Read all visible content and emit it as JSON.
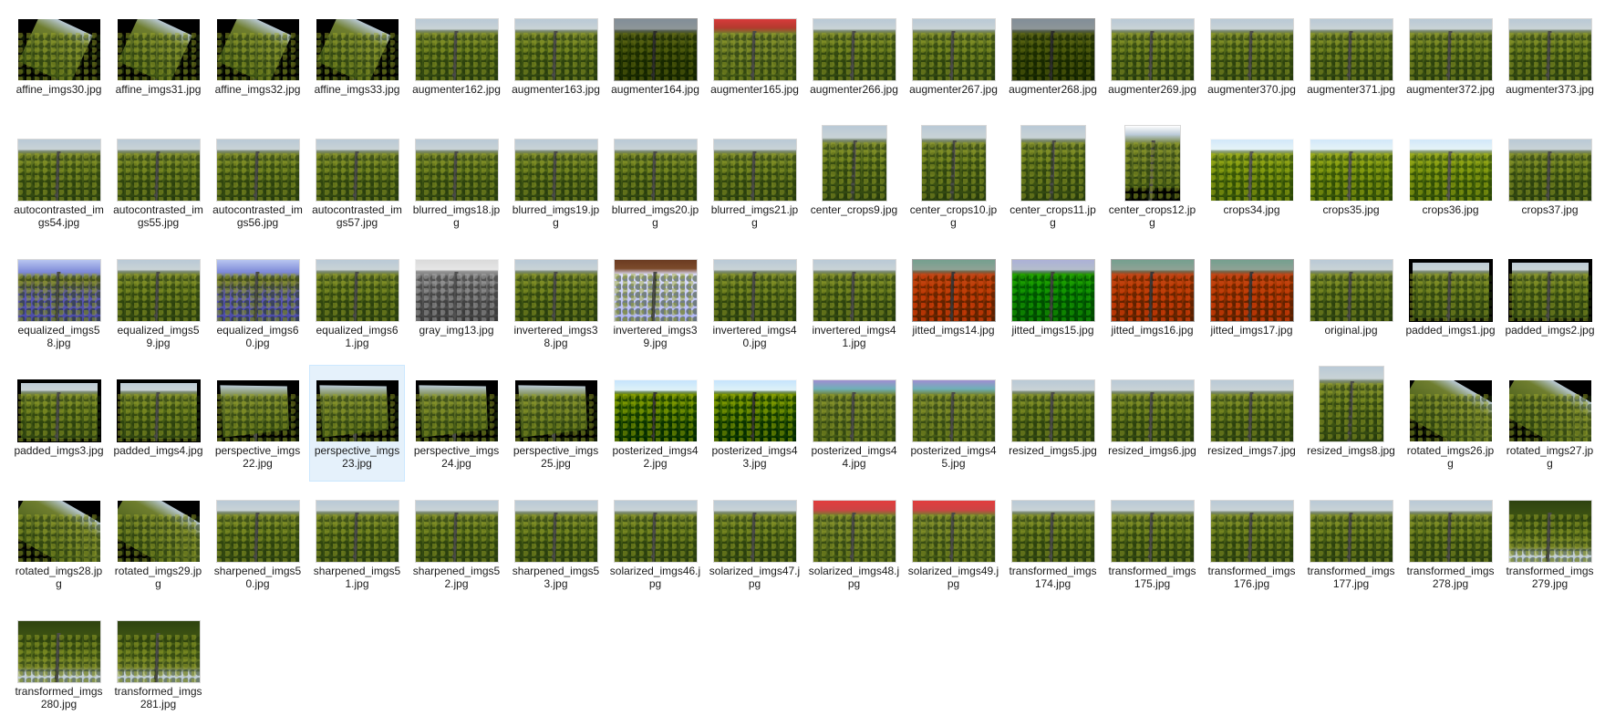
{
  "explorer": {
    "view": "large-icons",
    "selected_index": 51,
    "files": [
      {
        "name": "affine_imgs30.jpg",
        "variant": "affine"
      },
      {
        "name": "affine_imgs31.jpg",
        "variant": "affine"
      },
      {
        "name": "affine_imgs32.jpg",
        "variant": "affine"
      },
      {
        "name": "affine_imgs33.jpg",
        "variant": "affine"
      },
      {
        "name": "augmenter162.jpg",
        "variant": "normal"
      },
      {
        "name": "augmenter163.jpg",
        "variant": "normal"
      },
      {
        "name": "augmenter164.jpg",
        "variant": "dark"
      },
      {
        "name": "augmenter165.jpg",
        "variant": "redtop"
      },
      {
        "name": "augmenter266.jpg",
        "variant": "normal"
      },
      {
        "name": "augmenter267.jpg",
        "variant": "normal"
      },
      {
        "name": "augmenter268.jpg",
        "variant": "dark"
      },
      {
        "name": "augmenter269.jpg",
        "variant": "normal"
      },
      {
        "name": "augmenter370.jpg",
        "variant": "normal"
      },
      {
        "name": "augmenter371.jpg",
        "variant": "normal"
      },
      {
        "name": "augmenter372.jpg",
        "variant": "normal"
      },
      {
        "name": "augmenter373.jpg",
        "variant": "normal"
      },
      {
        "name": "autocontrasted_imgs54.jpg",
        "variant": "normal"
      },
      {
        "name": "autocontrasted_imgs55.jpg",
        "variant": "normal"
      },
      {
        "name": "autocontrasted_imgs56.jpg",
        "variant": "normal"
      },
      {
        "name": "autocontrasted_imgs57.jpg",
        "variant": "normal"
      },
      {
        "name": "blurred_imgs18.jpg",
        "variant": "normal"
      },
      {
        "name": "blurred_imgs19.jpg",
        "variant": "normal"
      },
      {
        "name": "blurred_imgs20.jpg",
        "variant": "normal"
      },
      {
        "name": "blurred_imgs21.jpg",
        "variant": "normal"
      },
      {
        "name": "center_crops9.jpg",
        "variant": "tall"
      },
      {
        "name": "center_crops10.jpg",
        "variant": "tall"
      },
      {
        "name": "center_crops11.jpg",
        "variant": "tall"
      },
      {
        "name": "center_crops12.jpg",
        "variant": "narrow"
      },
      {
        "name": "crops34.jpg",
        "variant": "bright"
      },
      {
        "name": "crops35.jpg",
        "variant": "bright"
      },
      {
        "name": "crops36.jpg",
        "variant": "bright"
      },
      {
        "name": "crops37.jpg",
        "variant": "normal"
      },
      {
        "name": "equalized_imgs58.jpg",
        "variant": "equalized"
      },
      {
        "name": "equalized_imgs59.jpg",
        "variant": "normal"
      },
      {
        "name": "equalized_imgs60.jpg",
        "variant": "equalized"
      },
      {
        "name": "equalized_imgs61.jpg",
        "variant": "normal"
      },
      {
        "name": "gray_img13.jpg",
        "variant": "gray"
      },
      {
        "name": "invertered_imgs38.jpg",
        "variant": "normal"
      },
      {
        "name": "invertered_imgs39.jpg",
        "variant": "inverted"
      },
      {
        "name": "invertered_imgs40.jpg",
        "variant": "normal"
      },
      {
        "name": "invertered_imgs41.jpg",
        "variant": "normal"
      },
      {
        "name": "jitted_imgs14.jpg",
        "variant": "red"
      },
      {
        "name": "jitted_imgs15.jpg",
        "variant": "green"
      },
      {
        "name": "jitted_imgs16.jpg",
        "variant": "red"
      },
      {
        "name": "jitted_imgs17.jpg",
        "variant": "red"
      },
      {
        "name": "original.jpg",
        "variant": "normal"
      },
      {
        "name": "padded_imgs1.jpg",
        "variant": "padded"
      },
      {
        "name": "padded_imgs2.jpg",
        "variant": "padded"
      },
      {
        "name": "padded_imgs3.jpg",
        "variant": "padded"
      },
      {
        "name": "padded_imgs4.jpg",
        "variant": "padded"
      },
      {
        "name": "perspective_imgs22.jpg",
        "variant": "persp"
      },
      {
        "name": "perspective_imgs23.jpg",
        "variant": "persp"
      },
      {
        "name": "perspective_imgs24.jpg",
        "variant": "persp"
      },
      {
        "name": "perspective_imgs25.jpg",
        "variant": "persp"
      },
      {
        "name": "posterized_imgs42.jpg",
        "variant": "poster"
      },
      {
        "name": "posterized_imgs43.jpg",
        "variant": "poster"
      },
      {
        "name": "posterized_imgs44.jpg",
        "variant": "posterpurple"
      },
      {
        "name": "posterized_imgs45.jpg",
        "variant": "posterpurple"
      },
      {
        "name": "resized_imgs5.jpg",
        "variant": "normal"
      },
      {
        "name": "resized_imgs6.jpg",
        "variant": "normal"
      },
      {
        "name": "resized_imgs7.jpg",
        "variant": "normal"
      },
      {
        "name": "resized_imgs8.jpg",
        "variant": "tall"
      },
      {
        "name": "rotated_imgs26.jpg",
        "variant": "rotated"
      },
      {
        "name": "rotated_imgs27.jpg",
        "variant": "rotated"
      },
      {
        "name": "rotated_imgs28.jpg",
        "variant": "rotated"
      },
      {
        "name": "rotated_imgs29.jpg",
        "variant": "rotated"
      },
      {
        "name": "sharpened_imgs50.jpg",
        "variant": "normal"
      },
      {
        "name": "sharpened_imgs51.jpg",
        "variant": "normal"
      },
      {
        "name": "sharpened_imgs52.jpg",
        "variant": "normal"
      },
      {
        "name": "sharpened_imgs53.jpg",
        "variant": "normal"
      },
      {
        "name": "solarized_imgs46.jpg",
        "variant": "normal"
      },
      {
        "name": "solarized_imgs47.jpg",
        "variant": "normal"
      },
      {
        "name": "solarized_imgs48.jpg",
        "variant": "solarred"
      },
      {
        "name": "solarized_imgs49.jpg",
        "variant": "solarred"
      },
      {
        "name": "transformed_imgs174.jpg",
        "variant": "normal"
      },
      {
        "name": "transformed_imgs175.jpg",
        "variant": "normal"
      },
      {
        "name": "transformed_imgs176.jpg",
        "variant": "normal"
      },
      {
        "name": "transformed_imgs177.jpg",
        "variant": "normal"
      },
      {
        "name": "transformed_imgs278.jpg",
        "variant": "normal"
      },
      {
        "name": "transformed_imgs279.jpg",
        "variant": "flipped"
      },
      {
        "name": "transformed_imgs280.jpg",
        "variant": "flipped"
      },
      {
        "name": "transformed_imgs281.jpg",
        "variant": "flipped"
      }
    ]
  }
}
